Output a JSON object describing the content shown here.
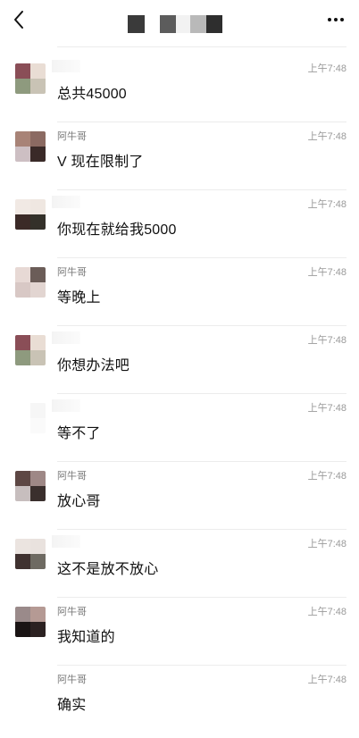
{
  "header": {
    "back_icon": "chevron-left-icon",
    "title_masked_colors": [
      "#3a3a3a",
      "#ffffff",
      "#5c5c5c",
      "#f2f2f2",
      "#b9b9b9",
      "#2e2e2e"
    ],
    "more_icon": "ellipsis-icon"
  },
  "messages": [
    {
      "sender": "",
      "time": "上午7:48",
      "text": "总共45000",
      "avatar_colors": [
        "#8a4e57",
        "#e9ddd4",
        "#8e9a7e",
        "#c9c3b5"
      ]
    },
    {
      "sender": "阿牛哥",
      "time": "上午7:48",
      "text": "V 现在限制了",
      "avatar_colors": [
        "#a88377",
        "#8b6a62",
        "#cdbfc3",
        "#3a2a28"
      ]
    },
    {
      "sender": "",
      "time": "上午7:48",
      "text": "你现在就给我5000",
      "avatar_colors": [
        "#f1e9e4",
        "#efe7e1",
        "#3b2a27",
        "#34312a"
      ]
    },
    {
      "sender": "阿牛哥",
      "time": "上午7:48",
      "text": "等晚上",
      "avatar_colors": [
        "#e7d9d5",
        "#6b5d58",
        "#d8c8c5",
        "#e2d5d1"
      ]
    },
    {
      "sender": "",
      "time": "上午7:48",
      "text": "你想办法吧",
      "avatar_colors": [
        "#8a4e57",
        "#e9ddd4",
        "#8e9a7e",
        "#c9c3b5"
      ]
    },
    {
      "sender": "",
      "time": "上午7:48",
      "text": "等不了",
      "avatar_colors": [
        "#ffffff",
        "#f6f6f6",
        "#ffffff",
        "#fafafa"
      ]
    },
    {
      "sender": "阿牛哥",
      "time": "上午7:48",
      "text": "放心哥",
      "avatar_colors": [
        "#5d4744",
        "#9e8886",
        "#c7bebe",
        "#3a2f2d"
      ]
    },
    {
      "sender": "",
      "time": "上午7:48",
      "text": "这不是放不放心",
      "avatar_colors": [
        "#ebe4e0",
        "#e9e2de",
        "#403230",
        "#6e6a62"
      ]
    },
    {
      "sender": "阿牛哥",
      "time": "上午7:48",
      "text": "我知道的",
      "avatar_colors": [
        "#9a8a8a",
        "#b59a94",
        "#1a1414",
        "#2b2121"
      ]
    },
    {
      "sender": "阿牛哥",
      "time": "上午7:48",
      "text": "确实",
      "avatar_colors": [
        "#ffffff",
        "#ffffff",
        "#ffffff",
        "#ffffff"
      ]
    }
  ]
}
